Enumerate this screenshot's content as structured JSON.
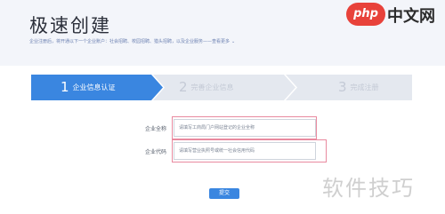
{
  "header": {
    "title": "极速创建",
    "subtitle": "企业注册后，将开通以下一个企业账户：社会招聘、校园招聘、猎头招聘，以及企业服务——查看更多"
  },
  "logo": {
    "badge": "php",
    "text": "中文网"
  },
  "steps": [
    {
      "number": "1",
      "label": "企业信息认证",
      "active": true
    },
    {
      "number": "2",
      "label": "完善企业信息",
      "active": false
    },
    {
      "number": "3",
      "label": "完成注册",
      "active": false
    }
  ],
  "form": {
    "company_name": {
      "label": "企业全称",
      "placeholder": "请填写工商局门户网站登记的企业全称"
    },
    "company_code": {
      "label": "企业代码",
      "placeholder": "请填写营业执照号或统一社会信用代码"
    },
    "submit_label": "提交"
  },
  "watermark": "软件技巧",
  "colors": {
    "accent": "#3a86e0",
    "step_inactive": "#e4e8ef",
    "header_bg": "#f3f5fa",
    "highlight": "#e98a9f",
    "logo_red": "#e8423a"
  }
}
